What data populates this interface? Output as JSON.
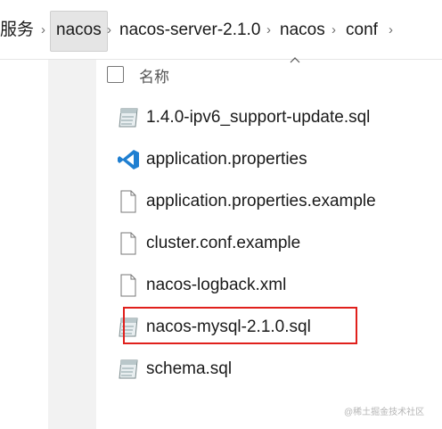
{
  "breadcrumb": {
    "items": [
      "服务",
      "nacos",
      "nacos-server-2.1.0",
      "nacos",
      "conf"
    ],
    "separator": "›"
  },
  "header": {
    "name_label": "名称",
    "sort_icon": "chevron-up-icon"
  },
  "files": [
    {
      "name": "1.4.0-ipv6_support-update.sql",
      "icon": "sql-file-icon"
    },
    {
      "name": "application.properties",
      "icon": "vscode-icon"
    },
    {
      "name": "application.properties.example",
      "icon": "document-icon"
    },
    {
      "name": "cluster.conf.example",
      "icon": "document-icon"
    },
    {
      "name": "nacos-logback.xml",
      "icon": "document-icon"
    },
    {
      "name": "nacos-mysql-2.1.0.sql",
      "icon": "sql-file-icon",
      "highlighted": true
    },
    {
      "name": "schema.sql",
      "icon": "sql-file-icon"
    }
  ],
  "watermark": "@稀土掘金技术社区",
  "colors": {
    "highlight": "#e0201c",
    "vscode_blue": "#1f7fd1",
    "active_crumb": "#e5e5e5"
  }
}
